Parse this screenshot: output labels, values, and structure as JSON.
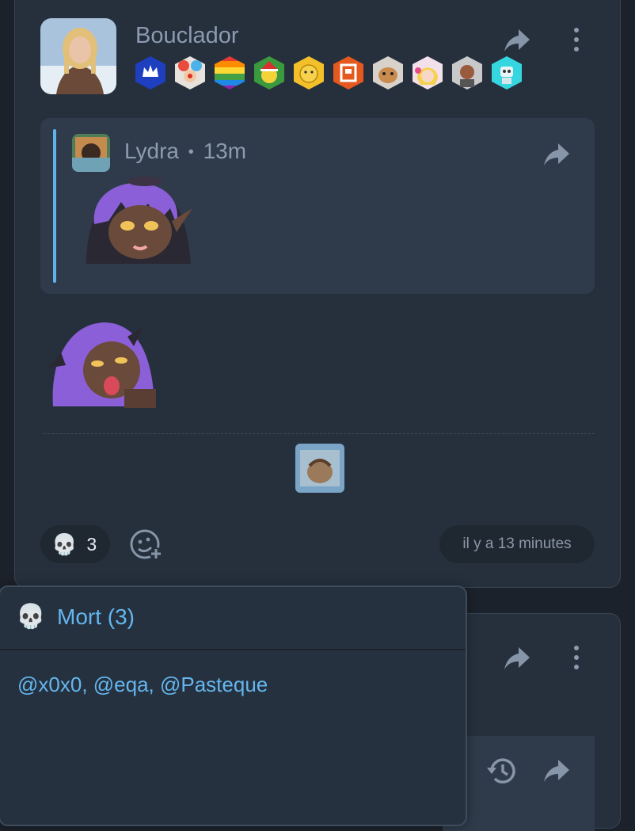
{
  "post": {
    "author": "Bouclador",
    "badges": [
      "crown-badge",
      "clown-badge",
      "rainbow-badge",
      "christmas-smiley-badge",
      "face-badge",
      "logo-badge",
      "cat-badge",
      "anime-girl-badge",
      "portrait-badge",
      "robot-badge"
    ],
    "quote": {
      "author": "Lydra",
      "separator": "•",
      "time": "13m"
    },
    "reaction": {
      "emoji": "💀",
      "count": "3"
    },
    "timestamp": "il y a 13 minutes"
  },
  "popover": {
    "emoji": "💀",
    "title": "Mort (3)",
    "users": "@x0x0, @eqa, @Pasteque"
  },
  "colors": {
    "accent": "#64b6ee",
    "background": "#1c222b",
    "card": "#26303d",
    "quote": "#2f3b4a"
  }
}
